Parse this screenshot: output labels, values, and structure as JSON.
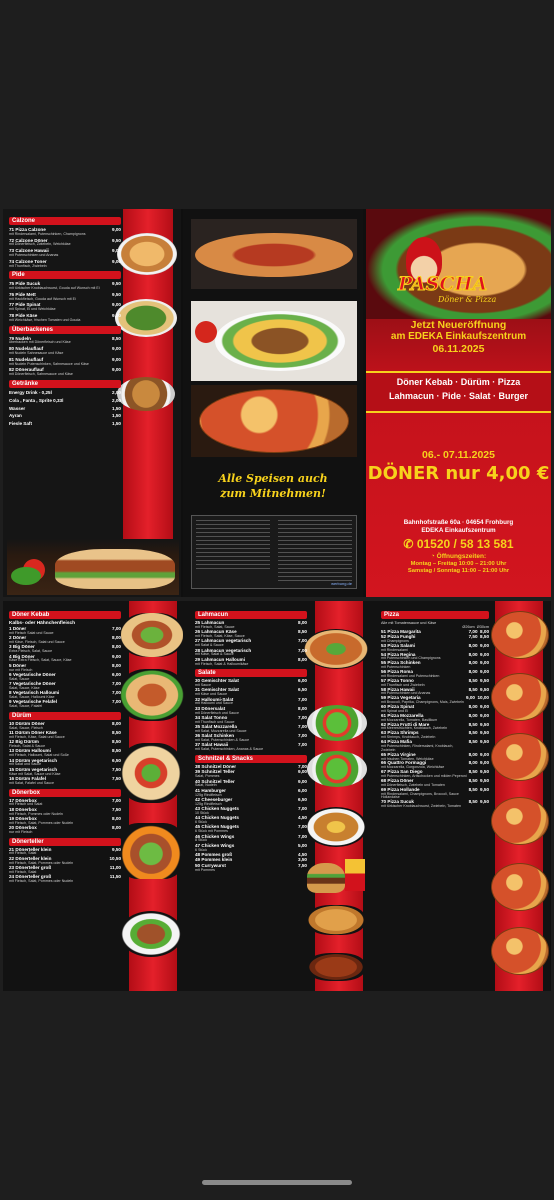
{
  "brand": {
    "name": "PASCHA",
    "sub": "Döner & Pizza"
  },
  "promo": {
    "line1": "Jetzt Neueröffnung",
    "line2": "am EDEKA Einkaufszentrum",
    "line3": "06.11.2025",
    "items1": "Döner Kebab · Dürüm · Pizza",
    "items2": "Lahmacun · Pide · Salat · Burger",
    "dates": "06.- 07.11.2025",
    "offer": "DÖNER nur 4,00 €"
  },
  "address": {
    "line1": "Bahnhofstraße 60a · 04654 Frohburg",
    "line2": "EDEKA Einkaufszentrum"
  },
  "phone": "01520 / 58 13 581",
  "hours": {
    "title": "Öffnungszeiten:",
    "line1": "Montag – Freitag 10:00 – 21:00 Uhr",
    "line2": "Samstag / Sonntag 11:00 – 21:00 Uhr"
  },
  "slogan": {
    "line1": "Alle Speisen auch",
    "line2": "zum Mitnehmen!"
  },
  "credit": "werbung.de",
  "top_left": {
    "calzone": {
      "title": "Calzone",
      "items": [
        {
          "name": "71 Pizza Calzone",
          "desc": "mit Rindersalami, Putenschinken, Champignons",
          "price": "9,00"
        },
        {
          "name": "72 Calzone Döner",
          "desc": "mit Dönerfleisch, Zwiebeln, Weichkäse",
          "price": "9,50"
        },
        {
          "name": "73 Calzone Hawaii",
          "desc": "mit Putenschinken und Ananas",
          "price": "9,00"
        },
        {
          "name": "74 Calzone Toner",
          "desc": "mit Thunfisch, Zwiebeln",
          "price": "9,00"
        }
      ]
    },
    "pide": {
      "title": "Pide",
      "items": [
        {
          "name": "75 Pide Sucuk",
          "desc": "mit türkischer Knoblauchwurst, Gouda auf Wunsch mit Ei",
          "price": "9,50"
        },
        {
          "name": "76 Pide Mett",
          "desc": "mit Hackfleisch, Gouda auf Wunsch mit Ei",
          "price": "9,50"
        },
        {
          "name": "77 Pide Spinat",
          "desc": "mit Spinat, Ei und Weichkäse",
          "price": "9,00"
        },
        {
          "name": "78 Pide Käse",
          "desc": "mit Weichkäse, frischen Tomaten und Gouda",
          "price": "9,00"
        }
      ]
    },
    "ueberbackenes": {
      "title": "Überbackenes",
      "items": [
        {
          "name": "79 Nudeln",
          "desc": "überbacken mit Dönerfleisch und Käse",
          "price": "8,50"
        },
        {
          "name": "80 Nudelauflauf",
          "desc": "mit Nudeln Sahnesauce und Käse",
          "price": "9,00"
        },
        {
          "name": "81 Nudelauflauf",
          "desc": "mit Nudeln Putenschinken, Sahnesauce und Käse",
          "price": "9,00"
        },
        {
          "name": "82 Dönerauflauf",
          "desc": "mit Dönerfleisch, Sahnesauce und Käse",
          "price": "9,00"
        }
      ]
    },
    "getraenke": {
      "title": "Getränke",
      "items": [
        {
          "name": "Energy Drink - 0,25l",
          "price": "2,00"
        },
        {
          "name": "Cola , Fanta , Sprite 0,33l",
          "price": "2,00"
        },
        {
          "name": "Wasser",
          "price": "1,50"
        },
        {
          "name": "Ayran",
          "price": "1,50"
        },
        {
          "name": "Fiesle Saft",
          "price": "1,50"
        }
      ]
    }
  },
  "bottom": {
    "doener_kebab": {
      "title": "Döner Kebab",
      "subtitle": "Kalbs- oder Hähnchenfleisch",
      "items": [
        {
          "name": "1 Döner",
          "desc": "mit Fleisch Salat und Sauce",
          "price": "7,00"
        },
        {
          "name": "2 Döner",
          "desc": "mit Käse, Fleisch, Salat und Sauce",
          "price": "8,00"
        },
        {
          "name": "3 Big Döner",
          "desc": "Extra Fleisch, Salat, Sauce",
          "price": "8,00"
        },
        {
          "name": "4 Big Döner",
          "desc": "Käse Extra Fleisch, Salat, Sauce, Käse",
          "price": "9,00"
        },
        {
          "name": "5 Döner",
          "desc": "nur mit Fleisch",
          "price": "8,00"
        },
        {
          "name": "6 Vegetarische Döner",
          "desc": "Salat, Sauce",
          "price": "6,00"
        },
        {
          "name": "7 Vegetarische Döner",
          "desc": "Salat, Sauce, Käse",
          "price": "7,00"
        },
        {
          "name": "8 Vegetarisch Halloumi",
          "desc": "Salat, Sauce, Halloumi Käse",
          "price": "7,00"
        },
        {
          "name": "9 Vegetarische Felafel",
          "desc": "Salat, Sauce, Falafel",
          "price": "7,00"
        }
      ]
    },
    "duerueem": {
      "title": "Dürüm",
      "items": [
        {
          "name": "10 Dürüm Döner",
          "desc": "Salat, Sauce, Fleisch",
          "price": "8,00"
        },
        {
          "name": "11 Dürüm Döner Käse",
          "desc": "mit Fleisch, Käse, Salat und Sauce",
          "price": "8,50"
        },
        {
          "name": "12 Big Dürüm",
          "desc": "Fleisch, Salat & Sauce",
          "price": "8,50"
        },
        {
          "name": "13 Dürüm Halloumi",
          "desc": "mit Fleisch, Halloumi, Salat und Soße",
          "price": "8,50"
        },
        {
          "name": "14 Dürüm vegetarisch",
          "desc": "mit Salat und Sauce",
          "price": "6,50"
        },
        {
          "name": "15 Dürüm vegetarisch",
          "desc": "Käse mit Salat, Sauce und Käse",
          "price": "7,50"
        },
        {
          "name": "16 Dürüm Falafel",
          "desc": "mit Salat, Falafel und Sauce",
          "price": "7,50"
        }
      ]
    },
    "doenerbox": {
      "title": "Dönerbox",
      "items": [
        {
          "name": "17 Dönerbox",
          "desc": "mit Fleisch und Salat",
          "price": "7,00"
        },
        {
          "name": "18 Dönerbox",
          "desc": "mit Fleisch, Pommes oder Nudeln",
          "price": "7,50"
        },
        {
          "name": "19 Dönerbox",
          "desc": "mit Fleisch, Salat, Pommes oder Nudeln",
          "price": "8,00"
        },
        {
          "name": "20 Dönerbox",
          "desc": "nur mit Fleisch",
          "price": "8,00"
        }
      ]
    },
    "doenerteller": {
      "title": "Dönerteller",
      "items": [
        {
          "name": "21 Dönerteller klein",
          "desc": "mit Fleisch, Salat",
          "price": "9,50"
        },
        {
          "name": "22 Dönerteller klein",
          "desc": "mit Fleisch, Salat, Pommes oder Nudeln",
          "price": "10,50"
        },
        {
          "name": "23 Dönerteller groß",
          "desc": "mit Fleisch, Salat",
          "price": "11,00"
        },
        {
          "name": "24 Dönerteller groß",
          "desc": "mit Fleisch, Salat, Pommes oder Nudeln",
          "price": "11,50"
        }
      ]
    },
    "lahmacun": {
      "title": "Lahmacun",
      "items": [
        {
          "name": "25 Lahmacun",
          "desc": "mit Fleisch, Salat, Sauce",
          "price": "8,00"
        },
        {
          "name": "26 Lahmacun Käse",
          "desc": "mit Fleisch, Salat, Käse, Sauce",
          "price": "8,50"
        },
        {
          "name": "27 Lahmacun vegetarisch",
          "desc": "mit Salat & Sauce",
          "price": "7,00"
        },
        {
          "name": "28 Lahmacun vegetarisch",
          "desc": "mit Käse, Salat & Sauce",
          "price": "7,00"
        },
        {
          "name": "29 Lahmacun Halloumi",
          "desc": "mit Fleisch, Salat & Halloumikäse",
          "price": "8,00"
        }
      ]
    },
    "salate": {
      "title": "Salate",
      "items": [
        {
          "name": "30 Gemischter Salat",
          "desc": "mit Sauce",
          "price": "6,00"
        },
        {
          "name": "31 Gemischter Salat",
          "desc": "mit Käse und Sauce",
          "price": "6,50"
        },
        {
          "name": "32 Halloumi-Salat",
          "desc": "mit Halloumi und Sauce",
          "price": "7,00"
        },
        {
          "name": "33 Dönersalat",
          "desc": "mit Dönerfleisch und Sauce",
          "price": "8,00"
        },
        {
          "name": "34 Salat Tonno",
          "desc": "mit Thunfisch und Sauce",
          "price": "7,00"
        },
        {
          "name": "35 Salat Mozzarella",
          "desc": "mit Salat, Mozzarella und Sauce",
          "price": "7,00"
        },
        {
          "name": "36 Salat Schinken",
          "desc": "mit Salat, Putenschinken & Sauce",
          "price": "7,00"
        },
        {
          "name": "37 Salat Hawaii",
          "desc": "mit Salat, Putenschinken, Ananas & Sauce",
          "price": "7,00"
        }
      ]
    },
    "schnitzel": {
      "title": "Schnitzel & Snacks",
      "items": [
        {
          "name": "38 Schnitzel Döner",
          "desc": "",
          "price": "7,00"
        },
        {
          "name": "39 Schnitzel Teller",
          "desc": "Salat, Pommes",
          "price": "9,00"
        },
        {
          "name": "40 Schnitzel Teller",
          "desc": "Salat, Nudeln",
          "price": "9,00"
        },
        {
          "name": "41 Hamburger",
          "desc": "125g Rindfleisch",
          "price": "6,00"
        },
        {
          "name": "42 Cheeseburger",
          "desc": "125g Rindfleisch",
          "price": "6,50"
        },
        {
          "name": "43 Chicken Nuggets",
          "desc": "10 Stück",
          "price": "7,00"
        },
        {
          "name": "44 Chicken Nuggets",
          "desc": "6 Stück",
          "price": "4,50"
        },
        {
          "name": "45 Chicken Nuggets",
          "desc": "6 Stück mit Pommes",
          "price": "7,00"
        },
        {
          "name": "46 Chicken Wings",
          "desc": "8 Stück",
          "price": "7,00"
        },
        {
          "name": "47 Chicken Wings",
          "desc": "6 Stück",
          "price": "5,00"
        },
        {
          "name": "48 Pommes groß",
          "desc": "",
          "price": "4,50"
        },
        {
          "name": "49 Pommes klein",
          "desc": "",
          "price": "3,50"
        },
        {
          "name": "50 Currywurst",
          "desc": "mit Pommes",
          "price": "7,50"
        }
      ]
    },
    "pizza": {
      "title": "Pizza",
      "subtitle": "Alle mit Tomatensauce und Käse",
      "sizes": "Ø26cm  Ø30cm",
      "items": [
        {
          "name": "51 Pizza Margarita",
          "desc": "",
          "price": "7,00  8,00"
        },
        {
          "name": "52 Pizza Funghi",
          "desc": "mit Champignons",
          "price": "7,50  8,50"
        },
        {
          "name": "53 Pizza Salami",
          "desc": "mit Rindersalami",
          "price": "8,00  9,00"
        },
        {
          "name": "54 Pizza Regina",
          "desc": "mit Putenschinken und Champignons",
          "price": "8,00  9,00"
        },
        {
          "name": "55 Pizza Schinken",
          "desc": "mit Putenschinken",
          "price": "8,00  9,00"
        },
        {
          "name": "56 Pizza Roma",
          "desc": "mit Rindersalami und Putenschinken",
          "price": "8,00  9,00"
        },
        {
          "name": "57 Pizza Tonno",
          "desc": "mit Thunfisch und Zwiebeln",
          "price": "8,50  9,50"
        },
        {
          "name": "58 Pizza Hawaii",
          "desc": "mit Putenschinken und Ananas",
          "price": "8,50  9,50"
        },
        {
          "name": "59 Pizza Vegetaria",
          "desc": "mit Broccoli, Paprika, Champignons, Mais, Zwiebeln",
          "price": "9,00  10,00"
        },
        {
          "name": "60 Pizza Spinat",
          "desc": "mit Spinat und Ei",
          "price": "8,00  9,00"
        },
        {
          "name": "61 Pizza Mozzarella",
          "desc": "mit Mozzarella, Tomaten, Basilikum",
          "price": "8,00  9,00"
        },
        {
          "name": "62 Pizza Frutti di Mare",
          "desc": "mit Meeresfrüchten, Knoblauch, Zwiebeln",
          "price": "8,50  9,50"
        },
        {
          "name": "63 Pizza Shrimps",
          "desc": "mit Shrimps, Knoblauch, Zwiebeln",
          "price": "8,50  9,50"
        },
        {
          "name": "64 Pizza Mafia",
          "desc": "mit Putenschinken, Rindersalami, Knoblauch, Zwiebeln",
          "price": "8,50  9,50"
        },
        {
          "name": "65 Pizza Virgine",
          "desc": "mit frischen Tomaten, Weichkäse",
          "price": "8,00  9,00"
        },
        {
          "name": "66 Quattro Formaggi",
          "desc": "mit Mozzarella, Gorgonzola, Weichkäse",
          "price": "8,00  9,00"
        },
        {
          "name": "67 Pizza San Diego",
          "desc": "mit Putenschinken, Artischocken und milden Peperoni",
          "price": "8,50  9,50"
        },
        {
          "name": "68 Pizza Döner",
          "desc": "mit Dönerfleisch, Zwiebeln und Tomaten",
          "price": "8,50  9,50"
        },
        {
          "name": "69 Pizza Hollande",
          "desc": "mit Rindersalami, Champignons, Broccoli, Sauce Hollandaise",
          "price": "8,50  9,50"
        },
        {
          "name": "70 Pizza Sucuk",
          "desc": "mit türkischer Knoblauchwurst, Zwiebeln, Tomaten",
          "price": "8,50  9,50"
        }
      ]
    }
  },
  "colors": {
    "red": "#d2121c",
    "yellow": "#f7d21c",
    "dark": "#1e1e1e"
  }
}
